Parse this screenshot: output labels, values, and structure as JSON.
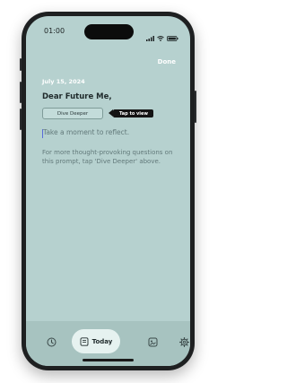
{
  "status_bar": {
    "time": "01:00",
    "signal_icon": "cellular-signal-icon",
    "wifi_icon": "wifi-icon",
    "battery_icon": "battery-icon"
  },
  "header": {
    "done_label": "Done"
  },
  "entry": {
    "date": "July 15, 2024",
    "greeting": "Dear Future Me,",
    "dive_deeper_label": "Dive Deeper",
    "tooltip_label": "Tap to view",
    "placeholder": "Take a moment to reflect.",
    "hint": "For more thought-provoking questions on this prompt, tap 'Dive Deeper' above."
  },
  "tabbar": {
    "items": [
      {
        "icon": "clock-icon",
        "label": ""
      },
      {
        "icon": "journal-icon",
        "label": "Today",
        "selected": true
      },
      {
        "icon": "photo-album-icon",
        "label": ""
      },
      {
        "icon": "gear-icon",
        "label": ""
      }
    ]
  },
  "colors": {
    "background": "#b6d1cf",
    "tabbar": "#a7c3c0",
    "tab_selected": "#e6f2f0",
    "tooltip": "#141414",
    "text_dark": "#1f2a2b",
    "text_muted": "#62797a"
  }
}
